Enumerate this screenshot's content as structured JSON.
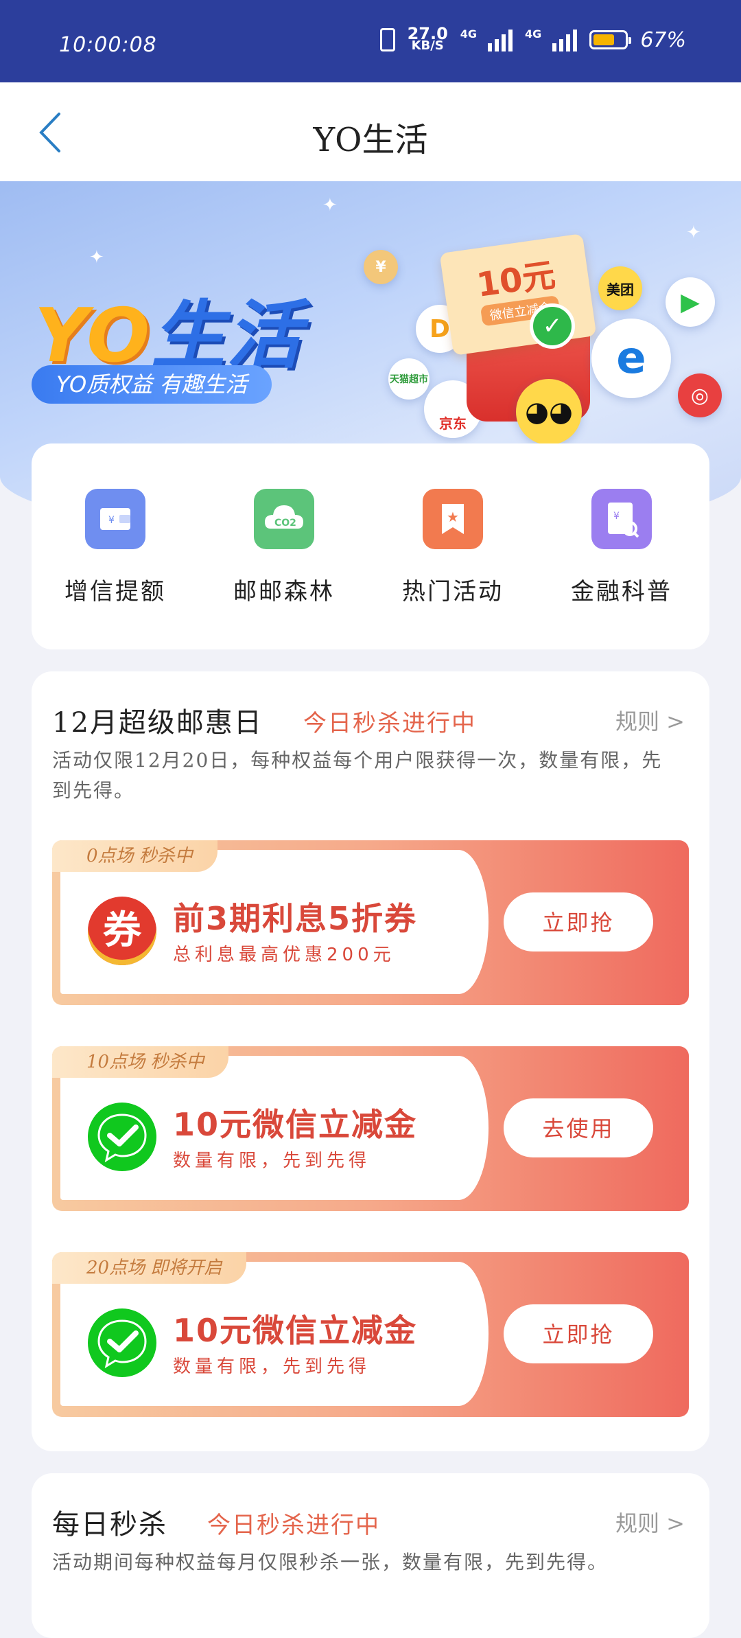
{
  "status_bar": {
    "time": "10:00:08",
    "net_speed": "27.0",
    "net_unit": "KB/S",
    "net_type_1": "4G",
    "net_type_2": "4G",
    "battery_percent": "67%",
    "battery_level": 0.67
  },
  "header": {
    "title": "YO生活"
  },
  "banner": {
    "brand_yo": "YO",
    "brand_life": "生活",
    "slogan": "YO质权益 有趣生活",
    "coupon_value": "10元",
    "coupon_caption": "微信立减金",
    "partner_meituan": "美团",
    "partner_jd": "京东",
    "partner_tmall": "天猫超市",
    "colors": {
      "yo": "#ffb21c",
      "life": "#2d6fe6"
    }
  },
  "quick_links": [
    {
      "label": "增信提额",
      "icon": "wallet-icon",
      "color": "#6f8ef0"
    },
    {
      "label": "邮邮森林",
      "icon": "co2-cloud-icon",
      "color": "#5cc47a"
    },
    {
      "label": "热门活动",
      "icon": "star-bookmark-icon",
      "color": "#f27a4f"
    },
    {
      "label": "金融科普",
      "icon": "finance-search-icon",
      "color": "#9b7ef0"
    }
  ],
  "promo": {
    "title": "12月超级邮惠日",
    "status": "今日秒杀进行中",
    "rules": "规则 >",
    "description": "活动仅限12月20日，每种权益每个用户限获得一次，数量有限，先到先得。",
    "deals": [
      {
        "tab": "0点场 秒杀中",
        "title": "前3期利息5折券",
        "subtitle": "总利息最高优惠200元",
        "button": "立即抢",
        "icon": "coupon-quan-icon",
        "icon_text": "券"
      },
      {
        "tab": "10点场 秒杀中",
        "title": "10元微信立减金",
        "subtitle": "数量有限，先到先得",
        "button": "去使用",
        "icon": "wechat-icon"
      },
      {
        "tab": "20点场 即将开启",
        "title": "10元微信立减金",
        "subtitle": "数量有限，先到先得",
        "button": "立即抢",
        "icon": "wechat-icon"
      }
    ]
  },
  "daily": {
    "title": "每日秒杀",
    "status": "今日秒杀进行中",
    "rules": "规则 >",
    "description": "活动期间每种权益每月仅限秒杀一张，数量有限，先到先得。"
  },
  "colors": {
    "status_bar": "#2c3e9c",
    "accent_red": "#d9483a",
    "page_bg": "#f1f2f8"
  }
}
